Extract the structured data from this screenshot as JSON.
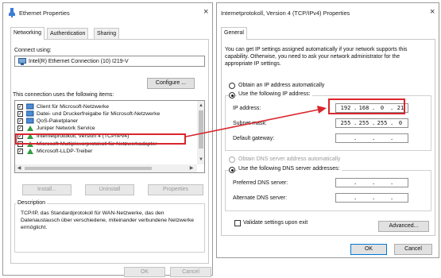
{
  "left_dialog": {
    "title": "Ethernet Properties",
    "tabs": [
      "Networking",
      "Authentication",
      "Sharing"
    ],
    "connect_using_label": "Connect using:",
    "adapter_name": "Intel(R) Ethernet Connection (10) I219-V",
    "configure_button": "Configure ...",
    "items_label": "This connection uses the following items:",
    "items": [
      {
        "label": "Client für Microsoft-Netzwerke",
        "checked": true
      },
      {
        "label": "Datei- und Druckerfreigabe für Microsoft-Netzwerke",
        "checked": true
      },
      {
        "label": "QoS-Paketplaner",
        "checked": true
      },
      {
        "label": "Juniper Network Service",
        "checked": true
      },
      {
        "label": "Internetprotokoll, Version 4 (TCP/IPv4)",
        "checked": true
      },
      {
        "label": "Microsoft-Multiplexorprotokoll für Netzwerkadapter",
        "checked": false
      },
      {
        "label": "Microsoft-LLDP-Treiber",
        "checked": true
      }
    ],
    "install_button": "Install...",
    "uninstall_button": "Uninstall",
    "properties_button": "Properties",
    "description_label": "Description",
    "description_text": "TCP/IP, das Standardprotokoll für WAN-Netzwerke, das den Datenaustausch über verschiedene, miteinander verbundene Netzwerke ermöglicht.",
    "ok_button": "OK",
    "cancel_button": "Cancel"
  },
  "right_dialog": {
    "title": "Internetprotokoll, Version 4 (TCP/IPv4) Properties",
    "tab": "General",
    "intro_text": "You can get IP settings assigned automatically if your network supports this capability. Otherwise, you need to ask your network administrator for the appropriate IP settings.",
    "obtain_ip_auto": "Obtain an IP address automatically",
    "use_following_ip": "Use the following IP address:",
    "ip_address_label": "IP address:",
    "ip_address": [
      "192",
      "168",
      "0",
      "21"
    ],
    "subnet_mask_label": "Subnet mask:",
    "subnet_mask": [
      "255",
      "255",
      "255",
      "0"
    ],
    "default_gateway_label": "Default gateway:",
    "obtain_dns_auto": "Obtain DNS server address automatically",
    "use_following_dns": "Use the following DNS server addresses:",
    "preferred_dns_label": "Preferred DNS server:",
    "alternate_dns_label": "Alternate DNS server:",
    "validate_label": "Validate settings upon exit",
    "advanced_button": "Advanced...",
    "ok_button": "OK",
    "cancel_button": "Cancel"
  },
  "colors": {
    "highlight_red": "#d9262c",
    "accent_blue": "#0078d7"
  }
}
